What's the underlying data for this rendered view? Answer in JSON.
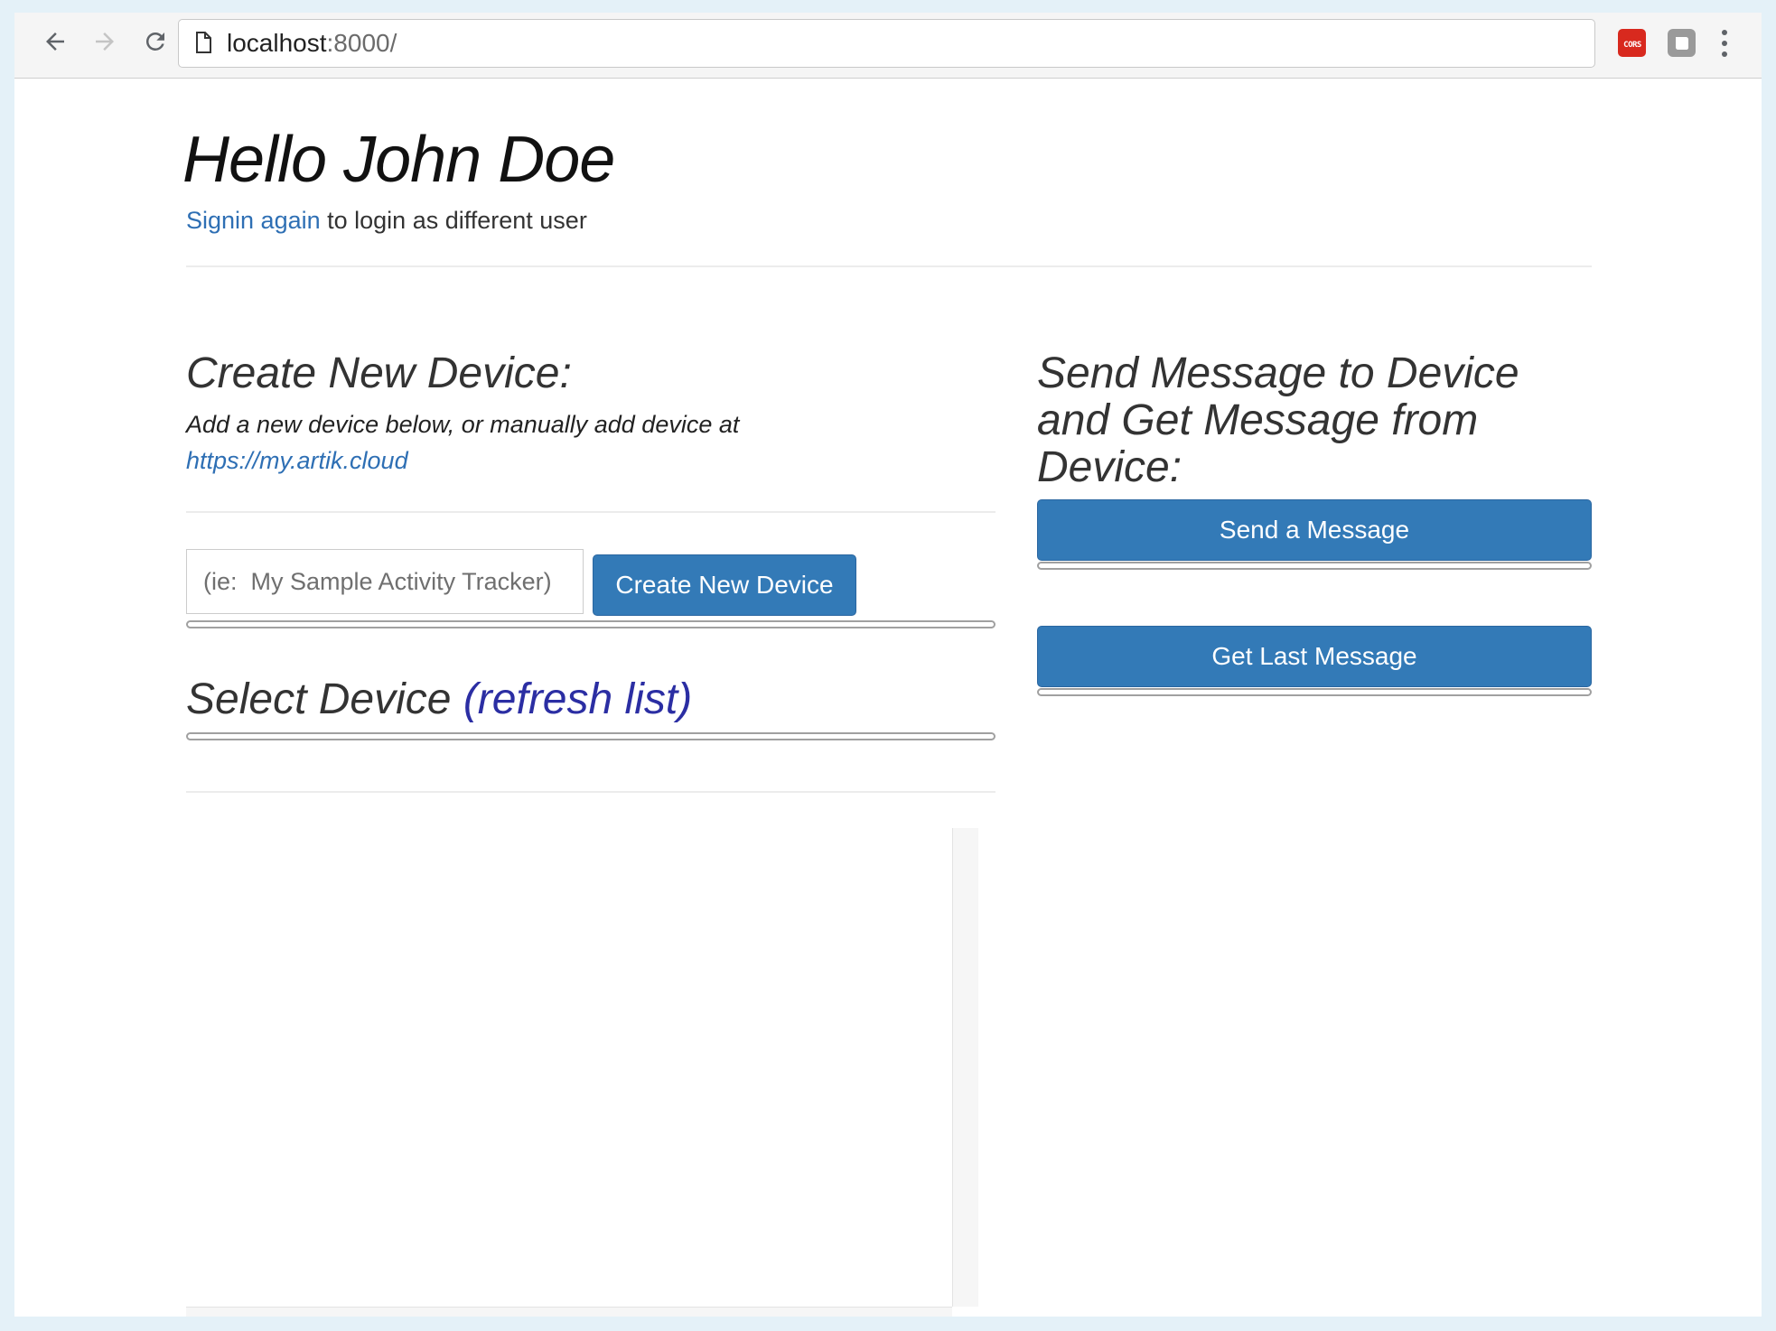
{
  "browser": {
    "url_host": "localhost",
    "url_path": ":8000/",
    "extensions": {
      "cors_label": "CORS"
    }
  },
  "header": {
    "greeting": "Hello John Doe",
    "signin_link": "Signin again",
    "signin_suffix": " to login as different user"
  },
  "create_device": {
    "title": "Create New Device:",
    "description": "Add a new device below, or manually add device at",
    "link": "https://my.artik.cloud",
    "input_placeholder": "(ie:  My Sample Activity Tracker)",
    "button_label": "Create New Device"
  },
  "select_device": {
    "title": "Select Device",
    "refresh_label": "(refresh list)"
  },
  "messages": {
    "title": "Send Message to Device and Get Message from Device:",
    "send_button": "Send a Message",
    "get_button": "Get Last Message"
  },
  "colors": {
    "primary": "#337ab7",
    "link": "#2e6fb4",
    "refresh_link": "#2b2ea3",
    "cors_badge": "#d8291e"
  }
}
